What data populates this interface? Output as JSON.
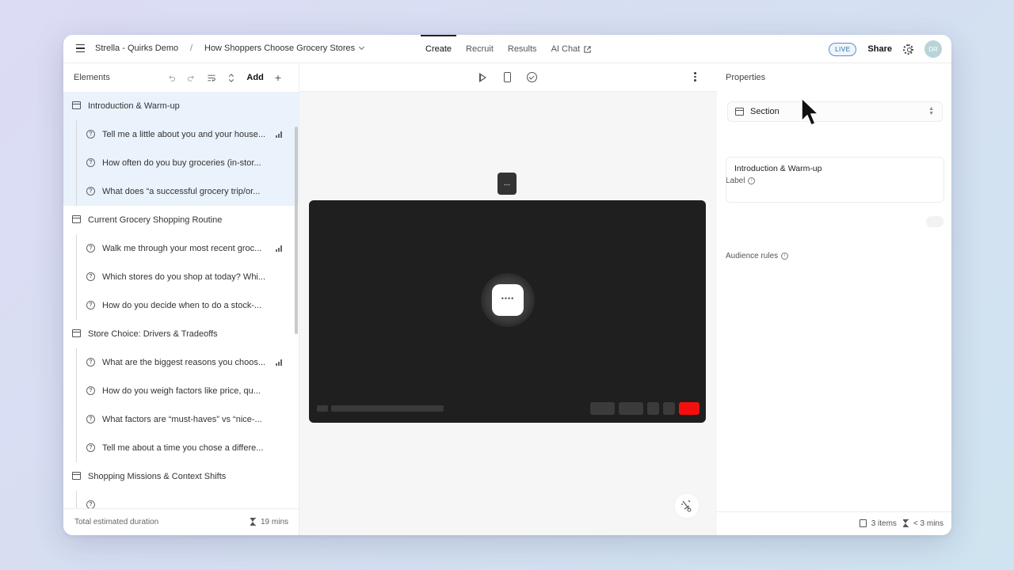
{
  "topbar": {
    "project": "Strella - Quirks Demo",
    "separator": "/",
    "study_title": "How Shoppers Choose Grocery Stores",
    "tabs": [
      {
        "label": "Create",
        "active": true
      },
      {
        "label": "Recruit",
        "active": false
      },
      {
        "label": "Results",
        "active": false
      },
      {
        "label": "AI Chat",
        "active": false
      }
    ],
    "live_badge": "LIVE",
    "share_label": "Share",
    "avatar_initials": "DR"
  },
  "elements_panel": {
    "title": "Elements",
    "add_label": "Add",
    "items": [
      {
        "type": "section",
        "label": "Introduction & Warm-up",
        "selected": true
      },
      {
        "type": "question",
        "label": "Tell me a little about you and your house...",
        "selected": true,
        "has_stats": true
      },
      {
        "type": "question",
        "label": "How often do you buy groceries (in-stor...",
        "selected": true
      },
      {
        "type": "question",
        "label": "What does “a successful grocery trip/or...",
        "selected": true
      },
      {
        "type": "section",
        "label": "Current Grocery Shopping Routine"
      },
      {
        "type": "question",
        "label": "Walk me through your most recent groc...",
        "has_stats": true
      },
      {
        "type": "question",
        "label": "Which stores do you shop at today? Whi..."
      },
      {
        "type": "question",
        "label": "How do you decide when to do a stock-..."
      },
      {
        "type": "section",
        "label": "Store Choice: Drivers & Tradeoffs"
      },
      {
        "type": "question",
        "label": "What are the biggest reasons you choos...",
        "has_stats": true
      },
      {
        "type": "question",
        "label": "How do you weigh factors like price, qu..."
      },
      {
        "type": "question",
        "label": "What factors are “must-haves” vs “nice-..."
      },
      {
        "type": "question",
        "label": "Tell me about a time you chose a differe..."
      },
      {
        "type": "section",
        "label": "Shopping Missions & Context Shifts"
      }
    ],
    "footer_label": "Total estimated duration",
    "footer_value": "19 mins"
  },
  "canvas": {
    "bubble_text": "...",
    "video_center_text": "••••"
  },
  "properties": {
    "title": "Properties",
    "type_value": "Section",
    "label_title": "Label",
    "label_value": "Introduction & Warm-up",
    "audience_rules_title": "Audience rules",
    "footer_items": "3 items",
    "footer_duration": "< 3 mins"
  },
  "colors": {
    "selected_row": "#eaf2fb",
    "live_badge": "#2d6aa6",
    "record_button": "#f40f0f"
  }
}
